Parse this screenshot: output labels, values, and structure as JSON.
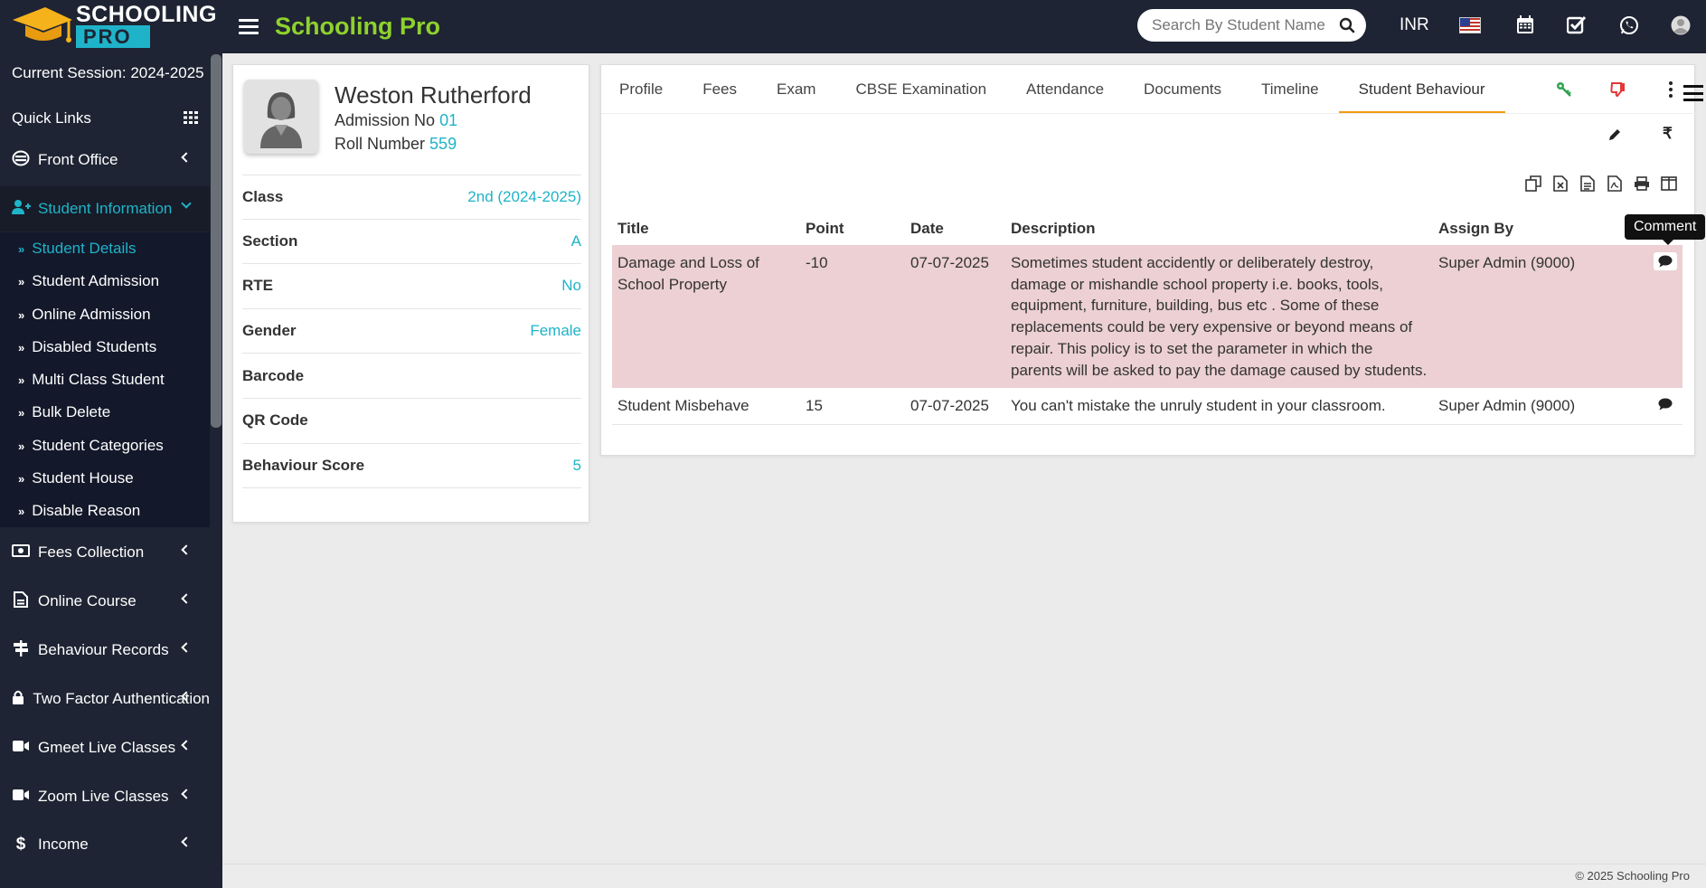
{
  "app": {
    "logo_top": "SCHOOLING",
    "logo_bottom": "PRO",
    "brand": "Schooling Pro",
    "search_placeholder": "Search By Student Name",
    "currency": "INR"
  },
  "sidebar": {
    "session": "Current Session: 2024-2025",
    "quick_links": "Quick Links",
    "menus": [
      {
        "label": "Front Office",
        "icon": "front-office-icon"
      },
      {
        "label": "Student Information",
        "icon": "user-plus-icon"
      },
      {
        "label": "Fees Collection",
        "icon": "money-icon"
      },
      {
        "label": "Online Course",
        "icon": "file-icon"
      },
      {
        "label": "Behaviour Records",
        "icon": "signpost-icon"
      },
      {
        "label": "Two Factor Authentication",
        "icon": "lock-icon"
      },
      {
        "label": "Gmeet Live Classes",
        "icon": "video-icon"
      },
      {
        "label": "Zoom Live Classes",
        "icon": "video-icon"
      },
      {
        "label": "Income",
        "icon": "dollar-icon"
      }
    ],
    "submenu": [
      "Student Details",
      "Student Admission",
      "Online Admission",
      "Disabled Students",
      "Multi Class Student",
      "Bulk Delete",
      "Student Categories",
      "Student House",
      "Disable Reason"
    ]
  },
  "student": {
    "name": "Weston Rutherford",
    "admission_label": "Admission No",
    "admission_no": "01",
    "roll_label": "Roll Number",
    "roll_no": "559",
    "fields": [
      {
        "key": "Class",
        "value": "2nd (2024-2025)"
      },
      {
        "key": "Section",
        "value": "A"
      },
      {
        "key": "RTE",
        "value": "No"
      },
      {
        "key": "Gender",
        "value": "Female"
      },
      {
        "key": "Barcode",
        "value": ""
      },
      {
        "key": "QR Code",
        "value": ""
      },
      {
        "key": "Behaviour Score",
        "value": "5"
      }
    ]
  },
  "tabs": [
    "Profile",
    "Fees",
    "Exam",
    "CBSE Examination",
    "Attendance",
    "Documents",
    "Timeline",
    "Student Behaviour"
  ],
  "behaviour": {
    "columns": [
      "Title",
      "Point",
      "Date",
      "Description",
      "Assign By"
    ],
    "rows": [
      {
        "title": "Damage and Loss of School Property",
        "point": "-10",
        "date": "07-07-2025",
        "description": "Sometimes student accidently or deliberately destroy, damage or mishandle school property i.e. books, tools, equipment, furniture, building, bus etc . Some of these replacements could be very expensive or beyond means of repair. This policy is to set the parameter in which the parents will be asked to pay the damage caused by students.",
        "assign_by": "Super Admin (9000)"
      },
      {
        "title": "Student Misbehave",
        "point": "15",
        "date": "07-07-2025",
        "description": "You can't mistake the unruly student in your classroom.",
        "assign_by": "Super Admin (9000)"
      }
    ],
    "tooltip": "Comment"
  },
  "footer": "© 2025 Schooling Pro",
  "colors": {
    "accent": "#1fb3c9",
    "brand": "#8fd12d",
    "sidebar": "#1e2433",
    "highlight_row": "#ecd0d3",
    "tab_active": "#f39c12"
  }
}
